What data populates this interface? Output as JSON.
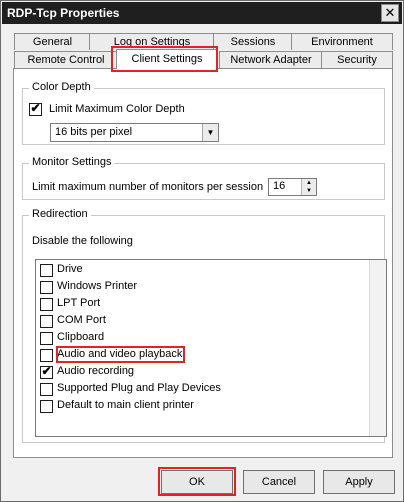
{
  "window": {
    "title": "RDP-Tcp Properties",
    "close_glyph": "✕"
  },
  "tabs_row1": [
    "General",
    "Log on Settings",
    "Sessions",
    "Environment"
  ],
  "tabs_row2": [
    "Remote Control",
    "Client Settings",
    "Network Adapter",
    "Security"
  ],
  "color_depth": {
    "title": "Color Depth",
    "limit_label": "Limit Maximum Color Depth",
    "limit_checked": true,
    "value": "16 bits per pixel"
  },
  "monitor": {
    "title": "Monitor Settings",
    "label": "Limit maximum number of monitors per session",
    "value": "16"
  },
  "redirection": {
    "title": "Redirection",
    "subtitle": "Disable the following",
    "items": [
      {
        "label": "Drive",
        "checked": false
      },
      {
        "label": "Windows Printer",
        "checked": false
      },
      {
        "label": "LPT Port",
        "checked": false
      },
      {
        "label": "COM Port",
        "checked": false
      },
      {
        "label": "Clipboard",
        "checked": false
      },
      {
        "label": "Audio and video playback",
        "checked": false
      },
      {
        "label": "Audio recording",
        "checked": true
      },
      {
        "label": "Supported Plug and Play Devices",
        "checked": false
      },
      {
        "label": "Default to main client printer",
        "checked": false
      }
    ]
  },
  "buttons": {
    "ok": "OK",
    "cancel": "Cancel",
    "apply": "Apply"
  },
  "glyphs": {
    "check": "✔",
    "down_arrow": "▼",
    "up_arrow": "▲"
  },
  "colors": {
    "highlight_box": "#e02424",
    "titlebar": "#1f1f1f"
  }
}
